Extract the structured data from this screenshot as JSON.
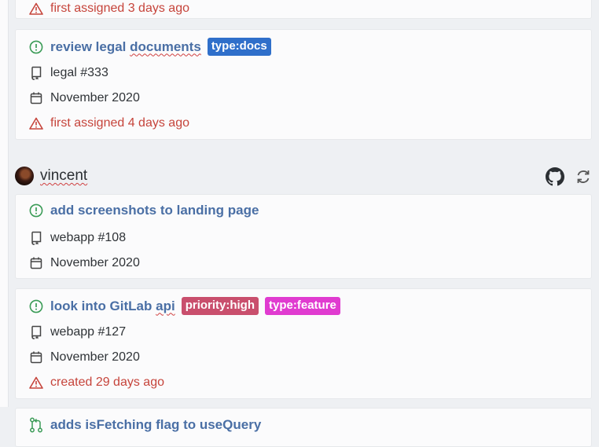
{
  "top_card": {
    "warning": "first assigned 3 days ago"
  },
  "card1": {
    "title_part1": "review legal",
    "title_part2": "documents",
    "badges": [
      {
        "label": "type:docs",
        "color": "#2f6fca"
      }
    ],
    "repo": "legal #333",
    "date": "November 2020",
    "warning": "first assigned 4 days ago"
  },
  "user": {
    "name": "vincent",
    "icons": [
      "github-icon",
      "refresh-icon"
    ]
  },
  "card2": {
    "title": "add screenshots to landing page",
    "repo": "webapp #108",
    "date": "November 2020"
  },
  "card3": {
    "title_part1": "look into GitLab",
    "title_part2": "api",
    "badges": [
      {
        "label": "priority:high",
        "color": "#c94f6d"
      },
      {
        "label": "type:feature",
        "color": "#e03bd0"
      }
    ],
    "repo": "webapp #127",
    "date": "November 2020",
    "warning": "created 29 days ago"
  },
  "card4": {
    "title": "adds isFetching flag to useQuery"
  },
  "colors": {
    "title": "#4a6fa5",
    "issue_open": "#3a9b56",
    "warning": "#c6443b",
    "background": "#eef0f3",
    "card": "#fbfbfc"
  }
}
